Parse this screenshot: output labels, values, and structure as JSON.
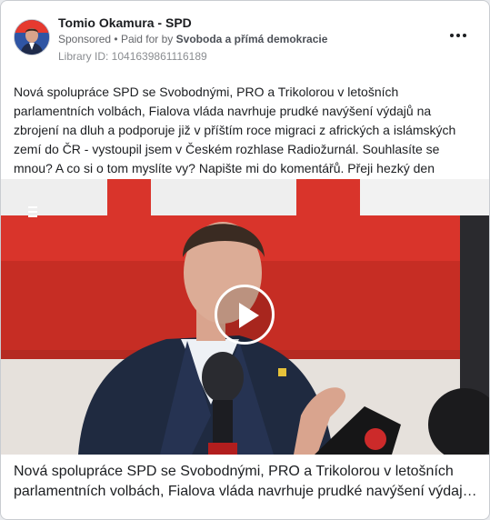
{
  "ad": {
    "page_name": "Tomio Okamura - SPD",
    "sponsored_label": "Sponsored",
    "paid_for_prefix": "Paid for by",
    "payer": "Svoboda a přímá demokracie",
    "library_id": "Library ID: 1041639861116189",
    "more_icon": "more-horizontal-icon"
  },
  "post": {
    "text": "Nová spolupráce SPD se Svobodnými, PRO a Trikolorou v letošních parlamentních volbách, Fialova vláda navrhuje prudké navýšení výdajů na zbrojení na dluh a podporuje již v příštím roce migraci z afrických a islámských zemí do ČR - vystoupil jsem v Českém rozhlase Radiožurnál. Souhlasíte se mnou? A co si o tom myslíte vy? Napište mi do komentářů. Přeji hezký den"
  },
  "media": {
    "play_icon": "play-icon",
    "colors": {
      "studio_red": "#d9342b",
      "wall_light": "#e8e3df"
    }
  },
  "caption": {
    "line1": "Nová spolupráce SPD se Svobodnými, PRO a Trikolorou v letošních",
    "line2": "parlamentních volbách, Fialova vláda navrhuje prudké navýšení výdajů na zbrojení na dluh a podporuje již v příštím roce migraci"
  }
}
